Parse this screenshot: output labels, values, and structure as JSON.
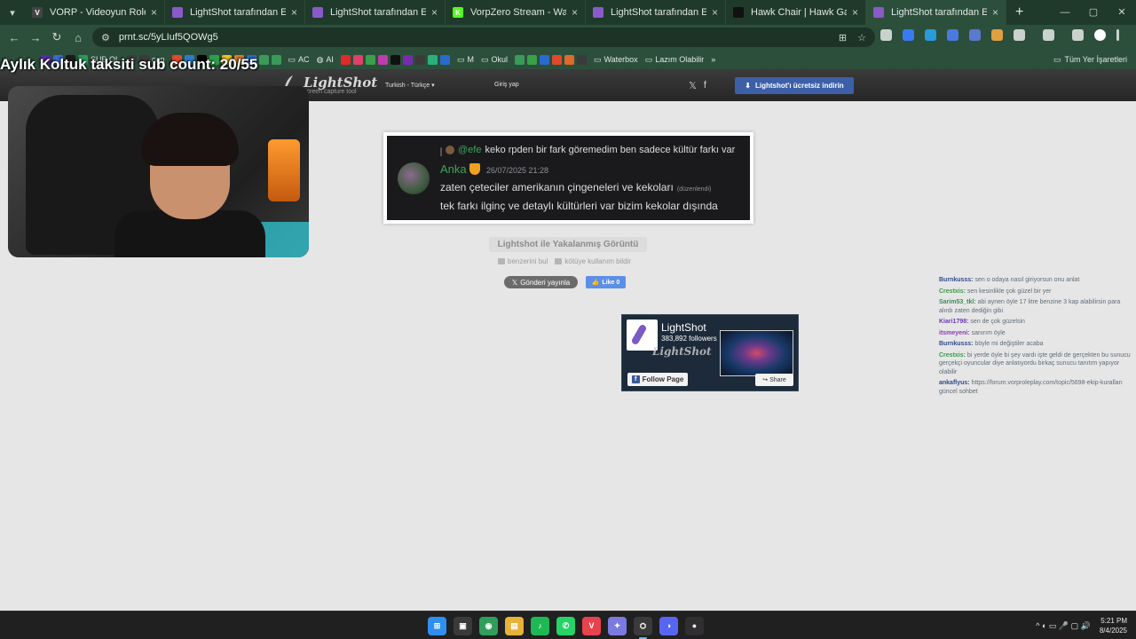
{
  "browser": {
    "tabs": [
      {
        "title": "VORP - Videoyun Roleplay",
        "icon_color": "#444444",
        "icon_text": "V",
        "active": false
      },
      {
        "title": "LightShot tarafından Ekran Görü",
        "icon_color": "#8a5ac8",
        "icon_text": "",
        "active": false
      },
      {
        "title": "LightShot tarafından Ekran Görü",
        "icon_color": "#8a5ac8",
        "icon_text": "",
        "active": false
      },
      {
        "title": "VorpZero Stream - Watch Live o",
        "icon_color": "#53fc18",
        "icon_text": "K",
        "active": false
      },
      {
        "title": "LightShot tarafından Ekran Görü",
        "icon_color": "#8a5ac8",
        "icon_text": "",
        "active": false
      },
      {
        "title": "Hawk Chair | Hawk Gaming Oy",
        "icon_color": "#111111",
        "icon_text": "",
        "active": false
      },
      {
        "title": "LightShot tarafından Ekran Görü",
        "icon_color": "#8a5ac8",
        "icon_text": "",
        "active": true
      }
    ],
    "url": "prnt.sc/5yLIuf5QOWg5",
    "bookmarks": [
      "SUB OL",
      "can",
      "AC",
      "AI",
      "M",
      "Okul",
      "Waterbox",
      "Lazım Olabilir"
    ],
    "bookmarks_all": "Tüm Yer İşaretleri",
    "icons": {
      "menu": "▾",
      "close": "×",
      "newtab": "+",
      "minimize": "—",
      "maximize": "▢",
      "window_close": "✕",
      "back": "←",
      "forward": "→",
      "reload": "↻",
      "home": "⌂",
      "tune": "⚙",
      "install": "⊞",
      "star": "☆",
      "folder": "▭",
      "more": "»"
    }
  },
  "overlay": {
    "sub_count": "Aylık Koltuk taksiti sub count: 20/55"
  },
  "lightshot": {
    "logo": "LightShot",
    "logo_sub": "screen capture tool",
    "language": "Turkish - Türkçe",
    "login": "Giriş yap",
    "download": "Lightshot'ı ücretsiz indirin",
    "social": {
      "twitter": "𝕏",
      "facebook": "f"
    },
    "download_icon": "⬇"
  },
  "screenshot": {
    "reply_mention": "@efe",
    "reply_text": "keko rpden bir fark göremedim ben sadece kültür farkı var",
    "username": "Anka",
    "timestamp": "26/07/2025 21:28",
    "line1": "zaten çeteciler amerikanın çingeneleri ve kekoları",
    "edited": "(düzenlendi)",
    "line2": "tek farkı ilginç ve detaylı kültürleri var bizim kekolar dışında"
  },
  "page": {
    "caption": "Lightshot ile Yakalanmış Görüntü",
    "similar": "benzerini bul",
    "report": "kötüye kullanım bildir",
    "tweet": "Gönderi yayınla",
    "tweet_icon": "𝕏",
    "like": "Like 0",
    "like_icon": "👍"
  },
  "facebook_box": {
    "name": "LightShot",
    "followers": "383,892 followers",
    "watermark": "LightShot",
    "follow": "Follow Page",
    "share": "Share",
    "share_icon": "↪"
  },
  "chat": [
    {
      "user": "Burnkusss:",
      "color": "#2f4b8a",
      "text": "sen o odaya nasıl giriyorsun onu anlat"
    },
    {
      "user": "Crestxis:",
      "color": "#3a9a4a",
      "text": "sen kesinlikle çok güzel bir yer"
    },
    {
      "user": "Sarim53_tkl:",
      "color": "#3a8a5a",
      "text": "abi aynen öyle 17 litre benzine 3 kap alabilirsin para alırdı zaten dediğin gibi"
    },
    {
      "user": "Kiari1798:",
      "color": "#6a3ab8",
      "text": "sen de çok güzelsin"
    },
    {
      "user": "itsmeyeni:",
      "color": "#8a3ab8",
      "text": "sanırım öyle"
    },
    {
      "user": "Burnkusss:",
      "color": "#2f4b8a",
      "text": "böyle mi değiştiler acaba"
    },
    {
      "user": "Crestxis:",
      "color": "#3a9a4a",
      "text": "bi yerde öyle bi şey vardı işte geldi de gerçekten bu sunucu gerçekçi oyuncular diye anlatıyordu birkaç sunucu tanıtım yapıyor olabilir"
    },
    {
      "user": "ankaflyus:",
      "color": "#2f4b8a",
      "text": "https://forum.vorproleplay.com/topic/5698-ekip-kuralları güncel sohbet"
    }
  ],
  "taskbar": {
    "apps": [
      {
        "name": "windows-start",
        "color": "#2f8ff0",
        "text": "⊞",
        "active": false
      },
      {
        "name": "task-view",
        "color": "#3a3a3a",
        "text": "▣",
        "active": false
      },
      {
        "name": "chrome",
        "color": "#2f9e5a",
        "text": "◉",
        "active": false
      },
      {
        "name": "file-explorer",
        "color": "#e6b23a",
        "text": "▤",
        "active": false
      },
      {
        "name": "spotify",
        "color": "#1db954",
        "text": "♪",
        "active": false
      },
      {
        "name": "whatsapp",
        "color": "#25d366",
        "text": "✆",
        "active": false
      },
      {
        "name": "valorant",
        "color": "#e8424d",
        "text": "V",
        "active": false
      },
      {
        "name": "copilot",
        "color": "#7a7adf",
        "text": "✦",
        "active": false
      },
      {
        "name": "steam",
        "color": "#1b2838",
        "text": "⛭",
        "active": true
      },
      {
        "name": "discord",
        "color": "#5865f2",
        "text": "◑",
        "active": false
      },
      {
        "name": "obs",
        "color": "#302e31",
        "text": "●",
        "active": false
      }
    ],
    "time": "5:21 PM",
    "date": "8/4/2025",
    "tray_icons": "^  ◐  ▭  🎤  ▢  🔊"
  }
}
